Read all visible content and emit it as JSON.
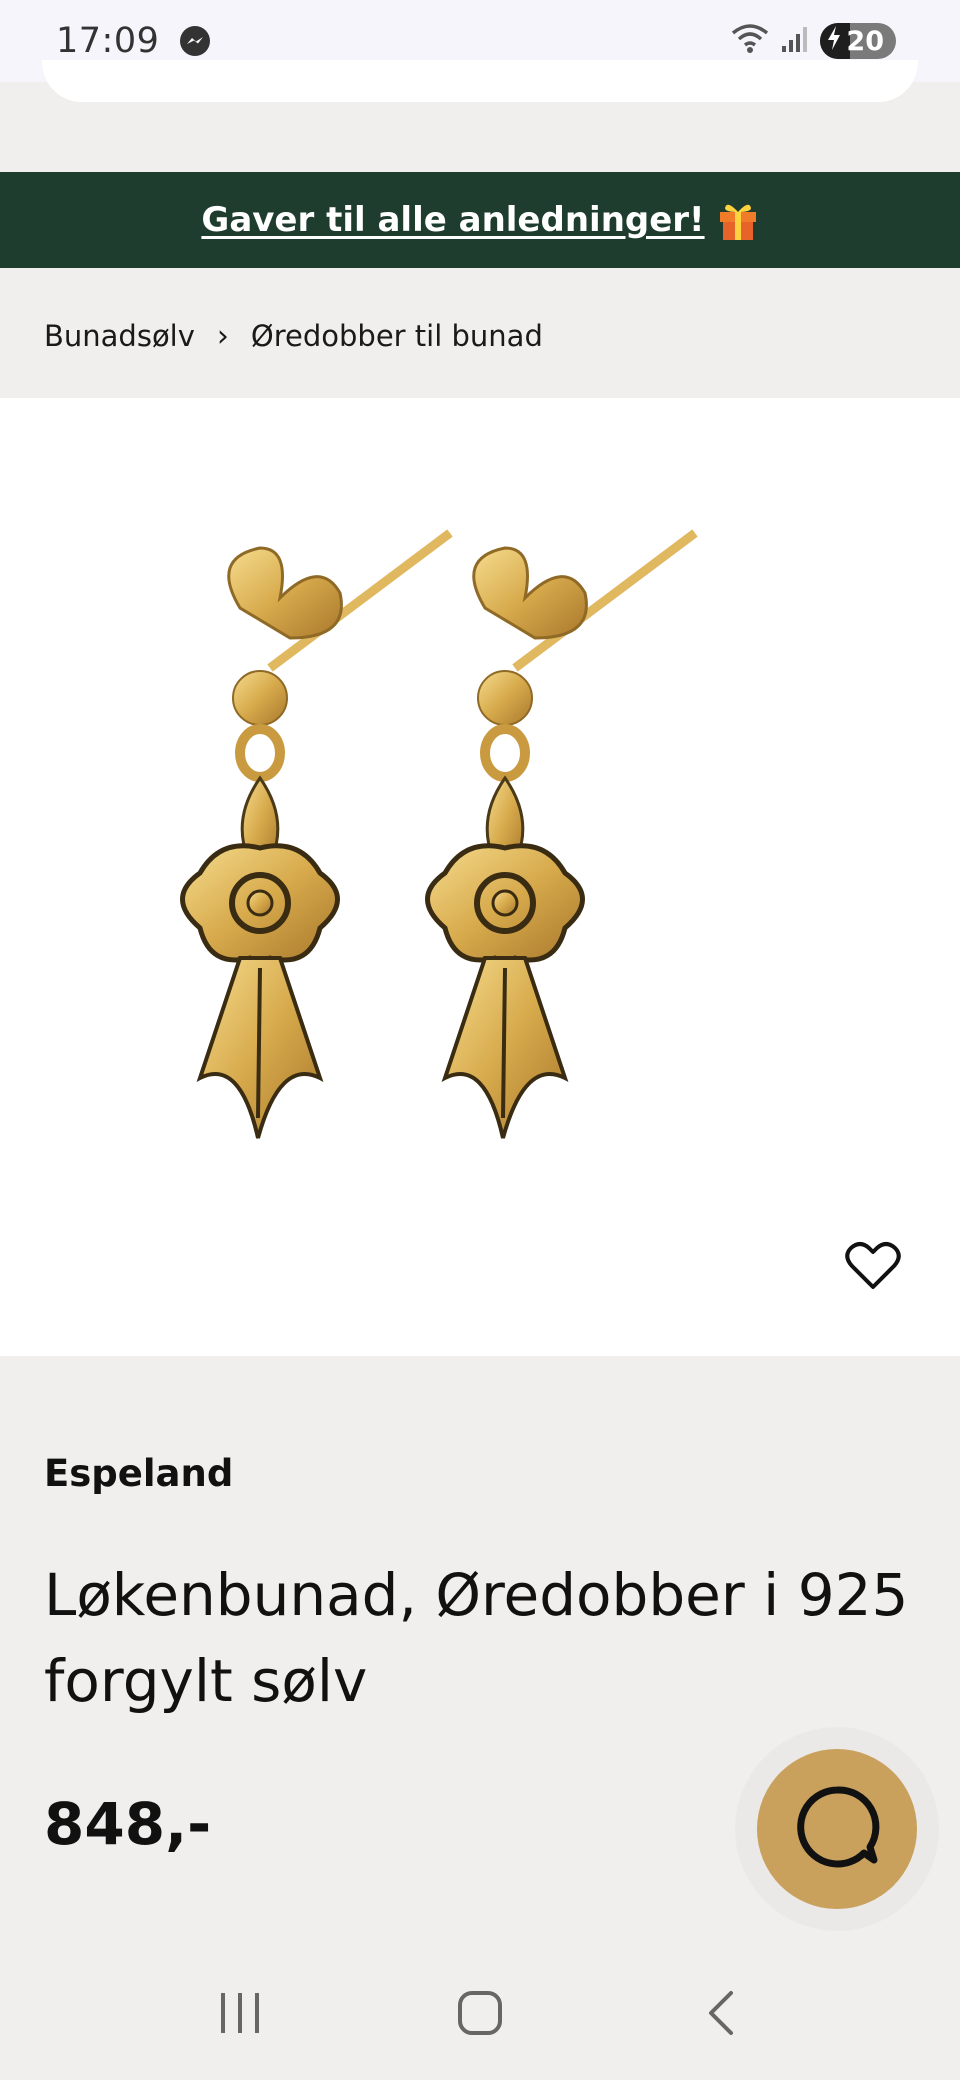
{
  "status_bar": {
    "time": "17:09",
    "battery_level": "20",
    "icons": [
      "messenger-icon",
      "wifi-icon",
      "signal-icon",
      "battery-charging-icon"
    ]
  },
  "promo": {
    "text": "Gaver til alle anledninger!",
    "icon": "gift-icon"
  },
  "breadcrumb": {
    "items": [
      "Bunadsølv",
      "Øredobber til bunad"
    ],
    "separator": "›"
  },
  "product": {
    "brand": "Espeland",
    "title": "Løkenbunad, Øredobber i 925 forgylt sølv",
    "price": "848,-",
    "image_icon": "gold-flower-earrings-image",
    "wishlist_icon": "heart-icon"
  },
  "chat": {
    "icon": "chat-bubble-icon",
    "color": "#c9a15d"
  },
  "nav_bar": {
    "buttons": [
      "recent-apps-icon",
      "home-icon",
      "back-icon"
    ]
  },
  "colors": {
    "banner_bg": "#1e3d2e",
    "page_bg": "#f0efed",
    "accent": "#c9a15d"
  }
}
